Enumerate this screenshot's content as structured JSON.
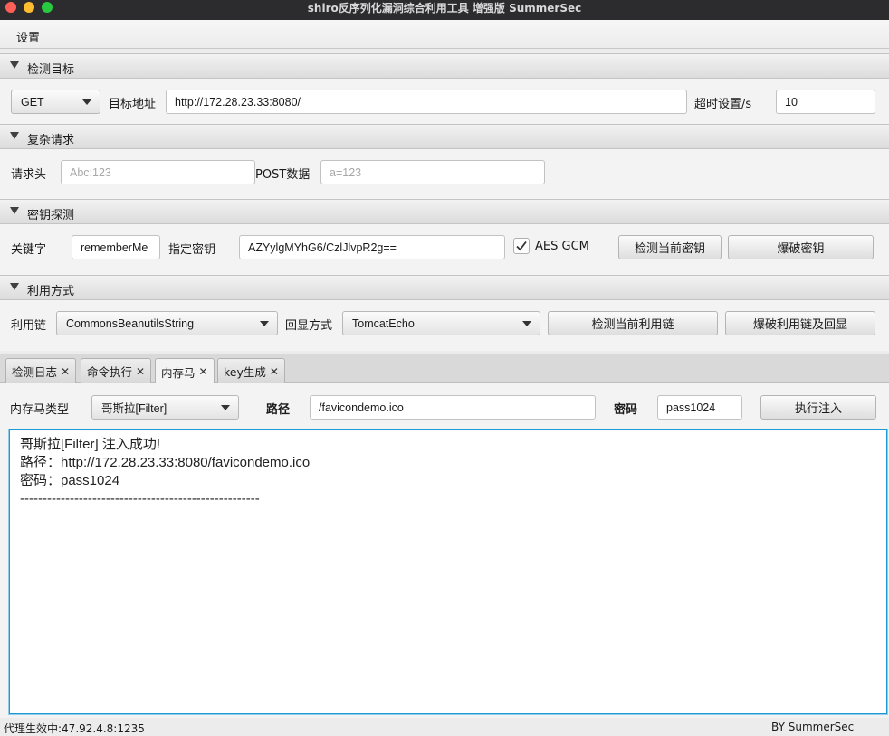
{
  "window": {
    "title": "shiro反序列化漏洞综合利用工具 增强版 SummerSec"
  },
  "colors": {
    "close": "#ff5f57",
    "minimize": "#febc2e",
    "zoom": "#28c840",
    "focus": "#1a9ad6"
  },
  "menu": {
    "settings": "设置"
  },
  "target": {
    "header": "检测目标",
    "method": "GET",
    "url_label": "目标地址",
    "url": "http://172.28.23.33:8080/",
    "timeout_label": "超时设置/s",
    "timeout": "10"
  },
  "complex": {
    "header": "复杂请求",
    "headers_label": "请求头",
    "headers_placeholder": "Abc:123",
    "post_label": "POST数据",
    "post_placeholder": "a=123"
  },
  "key": {
    "header": "密钥探测",
    "keyword_label": "关键字",
    "keyword": "rememberMe",
    "specify_label": "指定密钥",
    "key_value": "AZYylgMYhG6/CzlJlvpR2g==",
    "aes_gcm_label": "AES GCM",
    "detect_button": "检测当前密钥",
    "brute_button": "爆破密钥"
  },
  "exploit": {
    "header": "利用方式",
    "chain_label": "利用链",
    "chain": "CommonsBeanutilsString",
    "echo_label": "回显方式",
    "echo": "TomcatEcho",
    "detect_button": "检测当前利用链",
    "brute_button": "爆破利用链及回显"
  },
  "tabs": [
    {
      "label": "检测日志"
    },
    {
      "label": "命令执行"
    },
    {
      "label": "内存马"
    },
    {
      "label": "key生成"
    }
  ],
  "memshell": {
    "type_label": "内存马类型",
    "type": "哥斯拉[Filter]",
    "path_label": "路径",
    "path": "/favicondemo.ico",
    "password_label": "密码",
    "password": "pass1024",
    "inject_button": "执行注入",
    "output": "哥斯拉[Filter] 注入成功!\n路径：http://172.28.23.33:8080/favicondemo.ico\n密码：pass1024\n-----------------------------------------------------"
  },
  "status": {
    "proxy": "代理生效中:47.92.4.8:1235",
    "author": "BY  SummerSec"
  }
}
